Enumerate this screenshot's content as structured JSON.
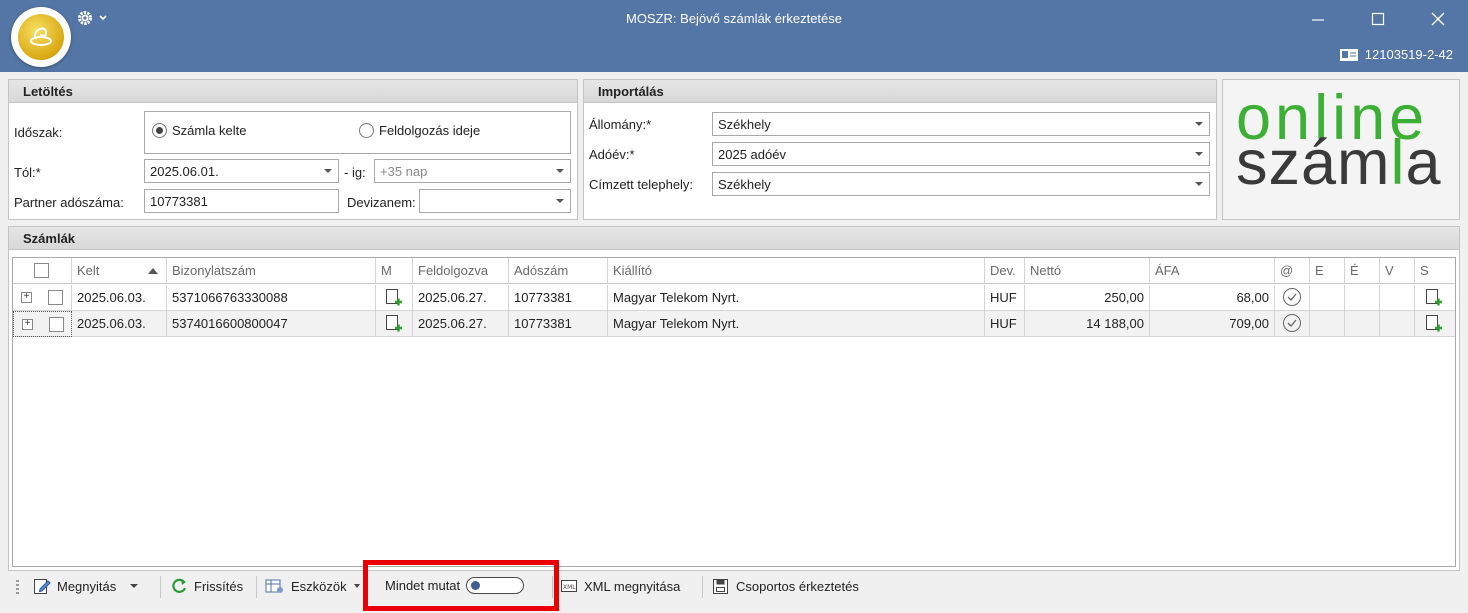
{
  "window": {
    "title": "MOSZR: Bejövő számlák érkeztetése",
    "user_id": "12103519-2-42"
  },
  "letoltes": {
    "header": "Letöltés",
    "idoszak_label": "Időszak:",
    "radio_szamla_kelte": "Számla kelte",
    "radio_feldolgozas_ideje": "Feldolgozás ideje",
    "radio_selected": "Számla kelte",
    "tol_label": "Tól:*",
    "tol_value": "2025.06.01.",
    "ig_label": "- ig:",
    "ig_placeholder": "+35 nap",
    "partner_label": "Partner adószáma:",
    "partner_value": "10773381",
    "devizanem_label": "Devizanem:",
    "devizanem_value": ""
  },
  "importalas": {
    "header": "Importálás",
    "allomany_label": "Állomány:*",
    "allomany_value": "Székhely",
    "adoev_label": "Adóév:*",
    "adoev_value": "2025 adóév",
    "telephely_label": "Címzett telephely:",
    "telephely_value": "Székhely"
  },
  "brand": {
    "line1": "online",
    "line2_a": "szám",
    "line2_b": "l",
    "line2_c": "a"
  },
  "szamlak": {
    "header": "Számlák",
    "columns": [
      "Kelt",
      "Bizonylatszám",
      "M",
      "Feldolgozva",
      "Adószám",
      "Kiállító",
      "Dev.",
      "Nettó",
      "ÁFA",
      "@",
      "E",
      "É",
      "V",
      "S"
    ],
    "rows": [
      {
        "kelt": "2025.06.03.",
        "bizonylatszam": "5371066763330088",
        "feldolgozva": "2025.06.27.",
        "adoszam": "10773381",
        "kiallito": "Magyar Telekom Nyrt.",
        "dev": "HUF",
        "netto": "250,00",
        "afa": "68,00"
      },
      {
        "kelt": "2025.06.03.",
        "bizonylatszam": "5374016600800047",
        "feldolgozva": "2025.06.27.",
        "adoszam": "10773381",
        "kiallito": "Magyar Telekom Nyrt.",
        "dev": "HUF",
        "netto": "14 188,00",
        "afa": "709,00"
      }
    ]
  },
  "toolbar": {
    "megnyitas": "Megnyitás",
    "frissites": "Frissítés",
    "eszkozok": "Eszközök",
    "mindet_mutat": "Mindet mutat",
    "mindet_mutat_on": false,
    "xml_megnyitasa": "XML megnyitása",
    "csoportos_erkeztetes": "Csoportos érkeztetés"
  },
  "colors": {
    "titlebar": "#5476a6",
    "brand_green": "#3cb035",
    "highlight": "#ea0000"
  }
}
